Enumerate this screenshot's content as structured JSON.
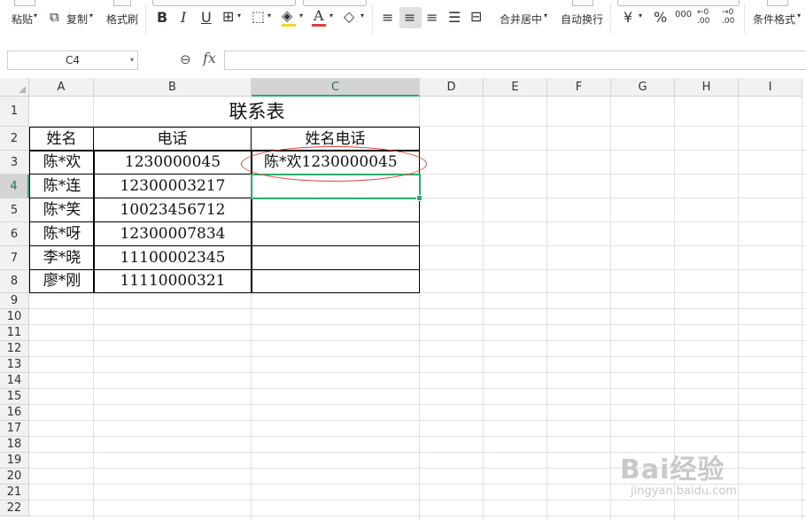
{
  "toolbar": {
    "paste": "粘贴",
    "copy": "复制",
    "format_painter": "格式刷",
    "bold": "B",
    "italic": "I",
    "underline": "U",
    "merge_center": "合并居中",
    "wrap_text": "自动换行",
    "currency": "¥",
    "percent": "%",
    "thousands": "000",
    "inc_decimal": "←0 .00",
    "dec_decimal": "→0 .00",
    "conditional_format": "条件格式"
  },
  "formula_bar": {
    "name_box": "C4",
    "fx_label": "fx",
    "formula": ""
  },
  "columns": [
    "A",
    "B",
    "C",
    "D",
    "E",
    "F",
    "G",
    "H",
    "I"
  ],
  "rows": [
    "1",
    "2",
    "3",
    "4",
    "5",
    "6",
    "7",
    "8",
    "9",
    "10",
    "11",
    "12",
    "13",
    "14",
    "15",
    "16",
    "17",
    "18",
    "19",
    "20",
    "21",
    "22"
  ],
  "selected": {
    "column": "C",
    "row": "4"
  },
  "sheet": {
    "title": "联系表",
    "headers": [
      "姓名",
      "电话",
      "姓名电话"
    ],
    "data": [
      {
        "name": "陈*欢",
        "phone": "1230000045",
        "combined": "陈*欢1230000045"
      },
      {
        "name": "陈*连",
        "phone": "12300003217",
        "combined": ""
      },
      {
        "name": "陈*笑",
        "phone": "10023456712",
        "combined": ""
      },
      {
        "name": "陈*呀",
        "phone": "12300007834",
        "combined": ""
      },
      {
        "name": "李*晓",
        "phone": "11100002345",
        "combined": ""
      },
      {
        "name": "廖*刚",
        "phone": "11110000321",
        "combined": ""
      }
    ]
  },
  "watermark": {
    "brand": "Bai经验",
    "url": "jingyan.baidu.com"
  },
  "colors": {
    "accent": "#2eaa6b",
    "annotation": "#e0413a"
  }
}
